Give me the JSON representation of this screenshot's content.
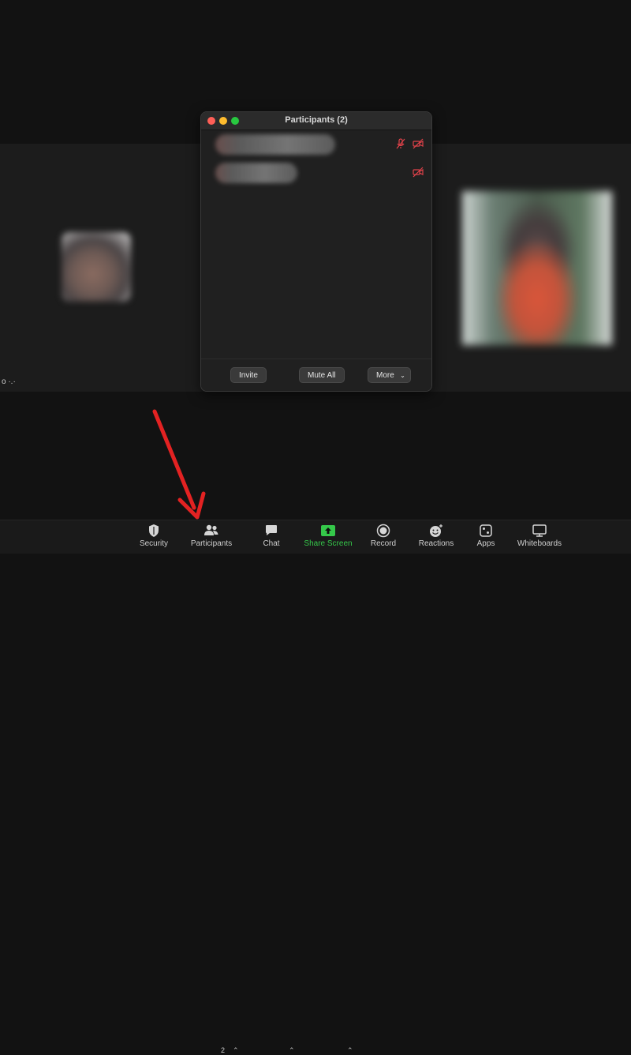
{
  "panel": {
    "title": "Participants (2)",
    "buttons": {
      "invite": "Invite",
      "mute_all": "Mute All",
      "more": "More"
    }
  },
  "gallery": {
    "left_tile_name": "o ·.·"
  },
  "toolbar": {
    "security": "Security",
    "participants": "Participants",
    "participants_count": "2",
    "chat": "Chat",
    "share_screen": "Share Screen",
    "record": "Record",
    "reactions": "Reactions",
    "apps": "Apps",
    "whiteboards": "Whiteboards"
  },
  "colors": {
    "accent_green": "#28c840",
    "share_green": "#35c84a",
    "muted_red": "#e0424a",
    "annotation_arrow": "#e32222"
  },
  "icons": [
    "shield-icon",
    "participants-icon",
    "chat-bubble-icon",
    "share-screen-icon",
    "record-icon",
    "reactions-icon",
    "apps-icon",
    "whiteboard-icon",
    "mic-muted-icon",
    "video-off-icon",
    "chevron-down-icon",
    "chevron-up-icon"
  ]
}
